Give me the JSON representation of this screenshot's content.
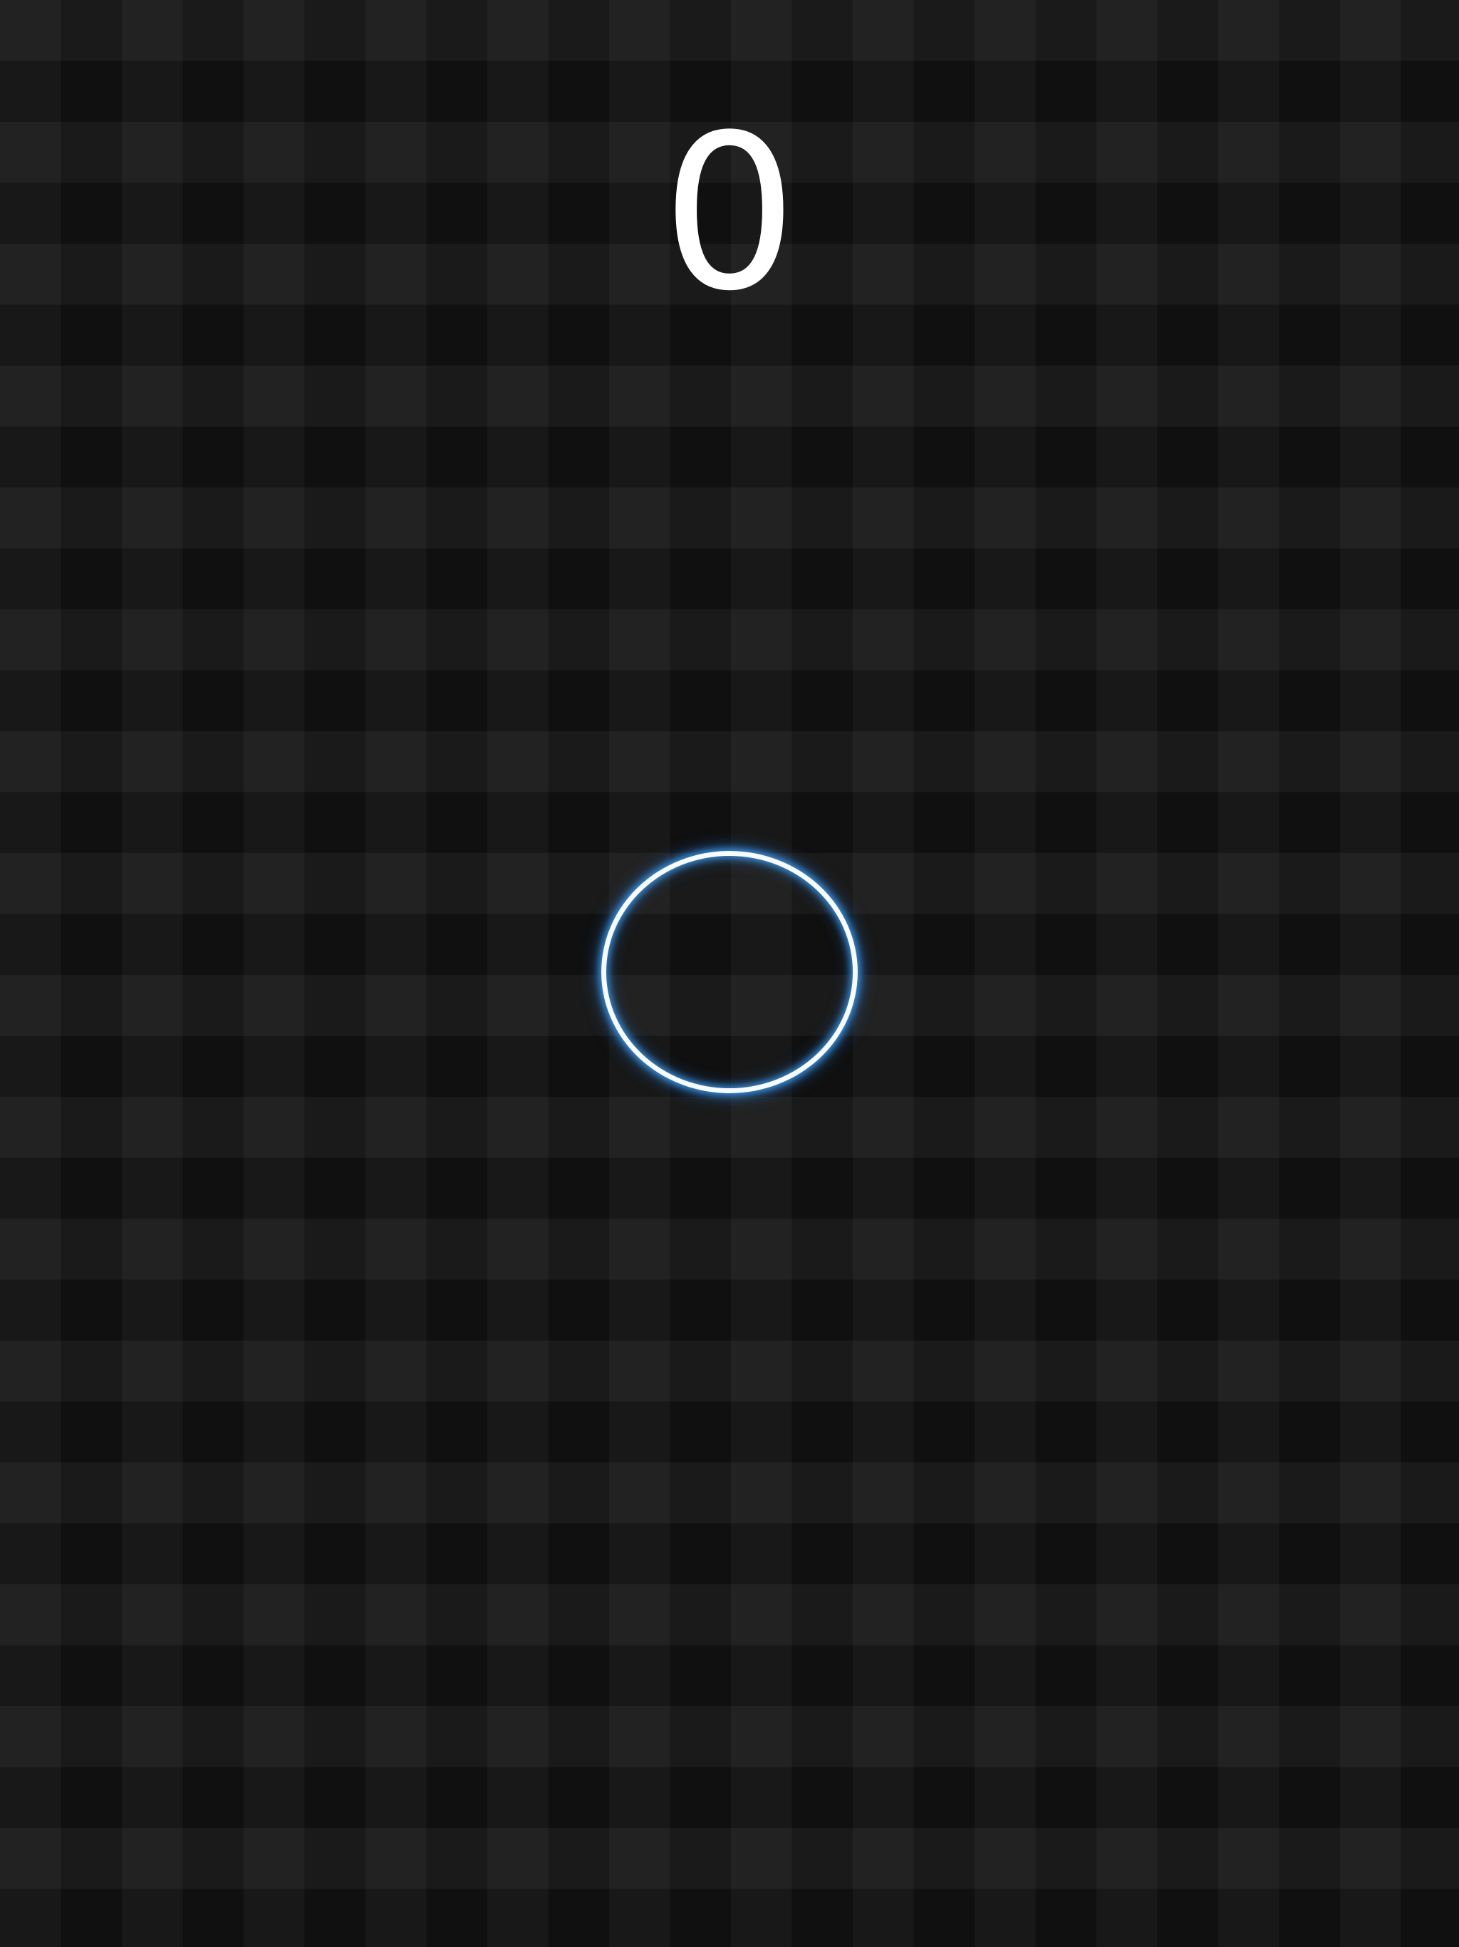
{
  "score": {
    "value": "0"
  },
  "ring": {
    "icon": "glowing-ring",
    "color": "#4ea5f0"
  },
  "background": {
    "base_color": "#141414"
  }
}
